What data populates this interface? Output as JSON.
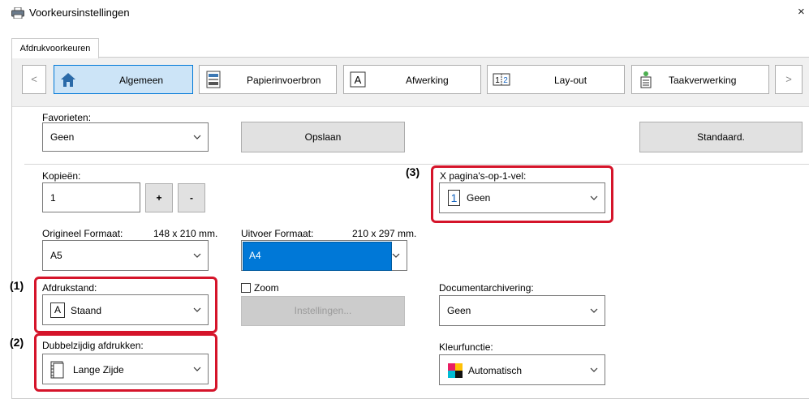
{
  "window": {
    "title": "Voorkeursinstellingen",
    "close": "×"
  },
  "tabs": [
    {
      "label": "Afdrukvoorkeuren"
    }
  ],
  "nav": {
    "prev": "<",
    "next": ">",
    "items": [
      {
        "label": "Algemeen",
        "icon": "home-icon",
        "selected": true
      },
      {
        "label": "Papierinvoerbron",
        "icon": "paper-tray-icon"
      },
      {
        "label": "Afwerking",
        "icon": "finishing-icon"
      },
      {
        "label": "Lay-out",
        "icon": "layout-icon"
      },
      {
        "label": "Taakverwerking",
        "icon": "job-handling-icon"
      }
    ]
  },
  "favorites": {
    "label": "Favorieten:",
    "value": "Geen",
    "save": "Opslaan",
    "default": "Standaard."
  },
  "copies": {
    "label": "Kopieën:",
    "value": "1",
    "plus": "+",
    "minus": "-"
  },
  "original_size": {
    "label": "Origineel Formaat:",
    "dims": "148 x 210 mm.",
    "value": "A5"
  },
  "output_size": {
    "label": "Uitvoer Formaat:",
    "dims": "210 x 297 mm.",
    "value": "A4"
  },
  "orientation": {
    "callout": "(1)",
    "label": "Afdrukstand:",
    "value": "Staand",
    "glyph": "A"
  },
  "duplex": {
    "callout": "(2)",
    "label": "Dubbelzijdig afdrukken:",
    "value": "Lange Zijde"
  },
  "nup": {
    "callout": "(3)",
    "label": "X pagina's-op-1-vel:",
    "value": "Geen",
    "glyph": "1"
  },
  "zoom": {
    "label": "Zoom",
    "settings": "Instellingen..."
  },
  "doc_archiving": {
    "label": "Documentarchivering:",
    "value": "Geen"
  },
  "color_mode": {
    "label": "Kleurfunctie:",
    "value": "Automatisch"
  },
  "colors": {
    "accent": "#0078d7",
    "highlight": "#d5142a",
    "selected_nav": "#cce4f7"
  }
}
